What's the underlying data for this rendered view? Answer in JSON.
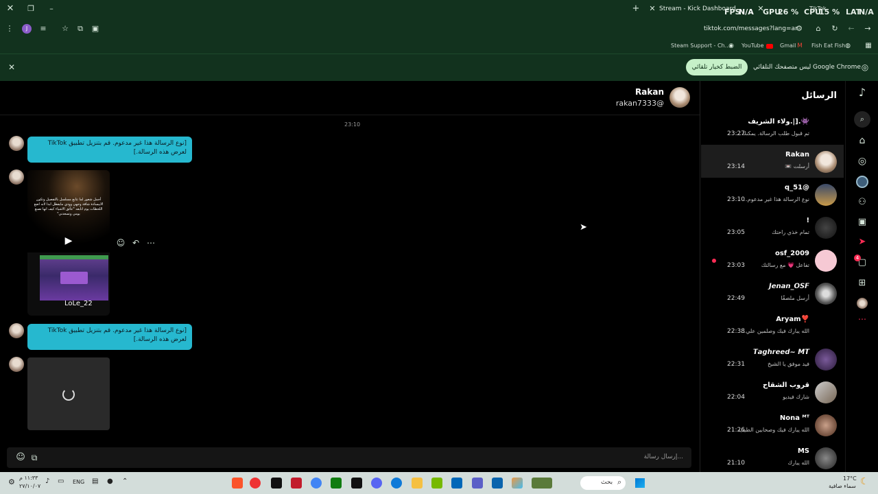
{
  "browser": {
    "tab_title": "Stream - Kick Dashboard",
    "tab_title_2": "TikTok",
    "url": "tiktok.com/messages?lang=ar",
    "overlay": {
      "fps_label": "FPS",
      "fps_val": "N/A",
      "gpu_label": "GPU",
      "gpu_val": "26 %",
      "cpu_label": "CPU",
      "cpu_val": "15 %",
      "lat_label": "LAT",
      "lat_val": "N/A"
    },
    "bookmarks": [
      "Steam Support - Ch...",
      "YouTube",
      "Gmail",
      "Fish Eat Fish"
    ],
    "infobar": {
      "text": "Google Chrome ليس متصفحك التلقائي",
      "button": "الضبط كخيار تلقائي"
    },
    "profile_letter": "J"
  },
  "chat": {
    "contact_name": "Rakan",
    "contact_handle": "rakan7333@",
    "timestamp": "23:10",
    "unsupported_msg_1": "[نوع الرسالة هذا غير مدعوم. قم بتنزيل تطبيق TikTok لعرض هذه الرسالة.]",
    "unsupported_msg_2": "[نوع الرسالة هذا غير مدعوم. قم بتنزيل تطبيق TikTok لعرض هذه الرسالة.]",
    "video_text": "أجمل شعور لما تتابع مسلسل بالتفصيل وتكون الايبسادة شافة وجهي وودي مايفطل ابدا لانه اضع اللحظات يوم اتابعه \"عائق الاشياء كيف انها تصنع يومي وتسعدني\"",
    "video_user": "LoLe_22",
    "input_placeholder": "إرسال رسالة..."
  },
  "inbox": {
    "title": "الرسائل",
    "conversations": [
      {
        "name": "ولاء الشريف.|].👾",
        "preview": "تم قبول طلب الرسالة. يمكنك...",
        "time": "23:27"
      },
      {
        "name": "Rakan",
        "preview": "أرسلت 📼",
        "time": "23:14"
      },
      {
        "name": "q_51@",
        "preview": "نوع الرسالة هذا غير مدعوم...",
        "time": "23:10"
      },
      {
        "name": "!",
        "preview": "تمام خذي راحتك",
        "time": "23:05"
      },
      {
        "name": "osf_2009",
        "preview": "تفاعل 💗 مع رسالتك",
        "time": "23:03"
      },
      {
        "name": "𝙅𝙚𝙣𝙖𝙣_𝙊𝙎𝙁",
        "preview": "أرسل ملصقًا",
        "time": "22:49"
      },
      {
        "name": "Aryam❣️",
        "preview": "الله يبارك فيك وصلمين علي...",
        "time": "22:38"
      },
      {
        "name": "𝙏𝙖𝙜𝙝𝙧𝙚𝙚𝙙~ 𝙈𝙏",
        "preview": "فيد موفق يا الشيخ",
        "time": "22:31"
      },
      {
        "name": "قروب الشقاح",
        "preview": "شارك فيديو",
        "time": "22:04"
      },
      {
        "name": "Nona ᴹᵀ",
        "preview": "الله يبارك فيك وصحابين الطيب",
        "time": "21:26"
      },
      {
        "name": "MS",
        "preview": "الله يبارك",
        "time": "21:10"
      }
    ],
    "badge": "4"
  },
  "taskbar": {
    "lang": "ENG",
    "time": "١١:٣٣ م",
    "date": "٢٧/١٠/٠٧",
    "search": "بحث",
    "weather_temp": "17°C",
    "weather_desc": "سماء صافية"
  },
  "colors": {
    "chrome_bg": "#12321e",
    "bubble": "#26b8cf",
    "accent": "#fe2c55"
  }
}
